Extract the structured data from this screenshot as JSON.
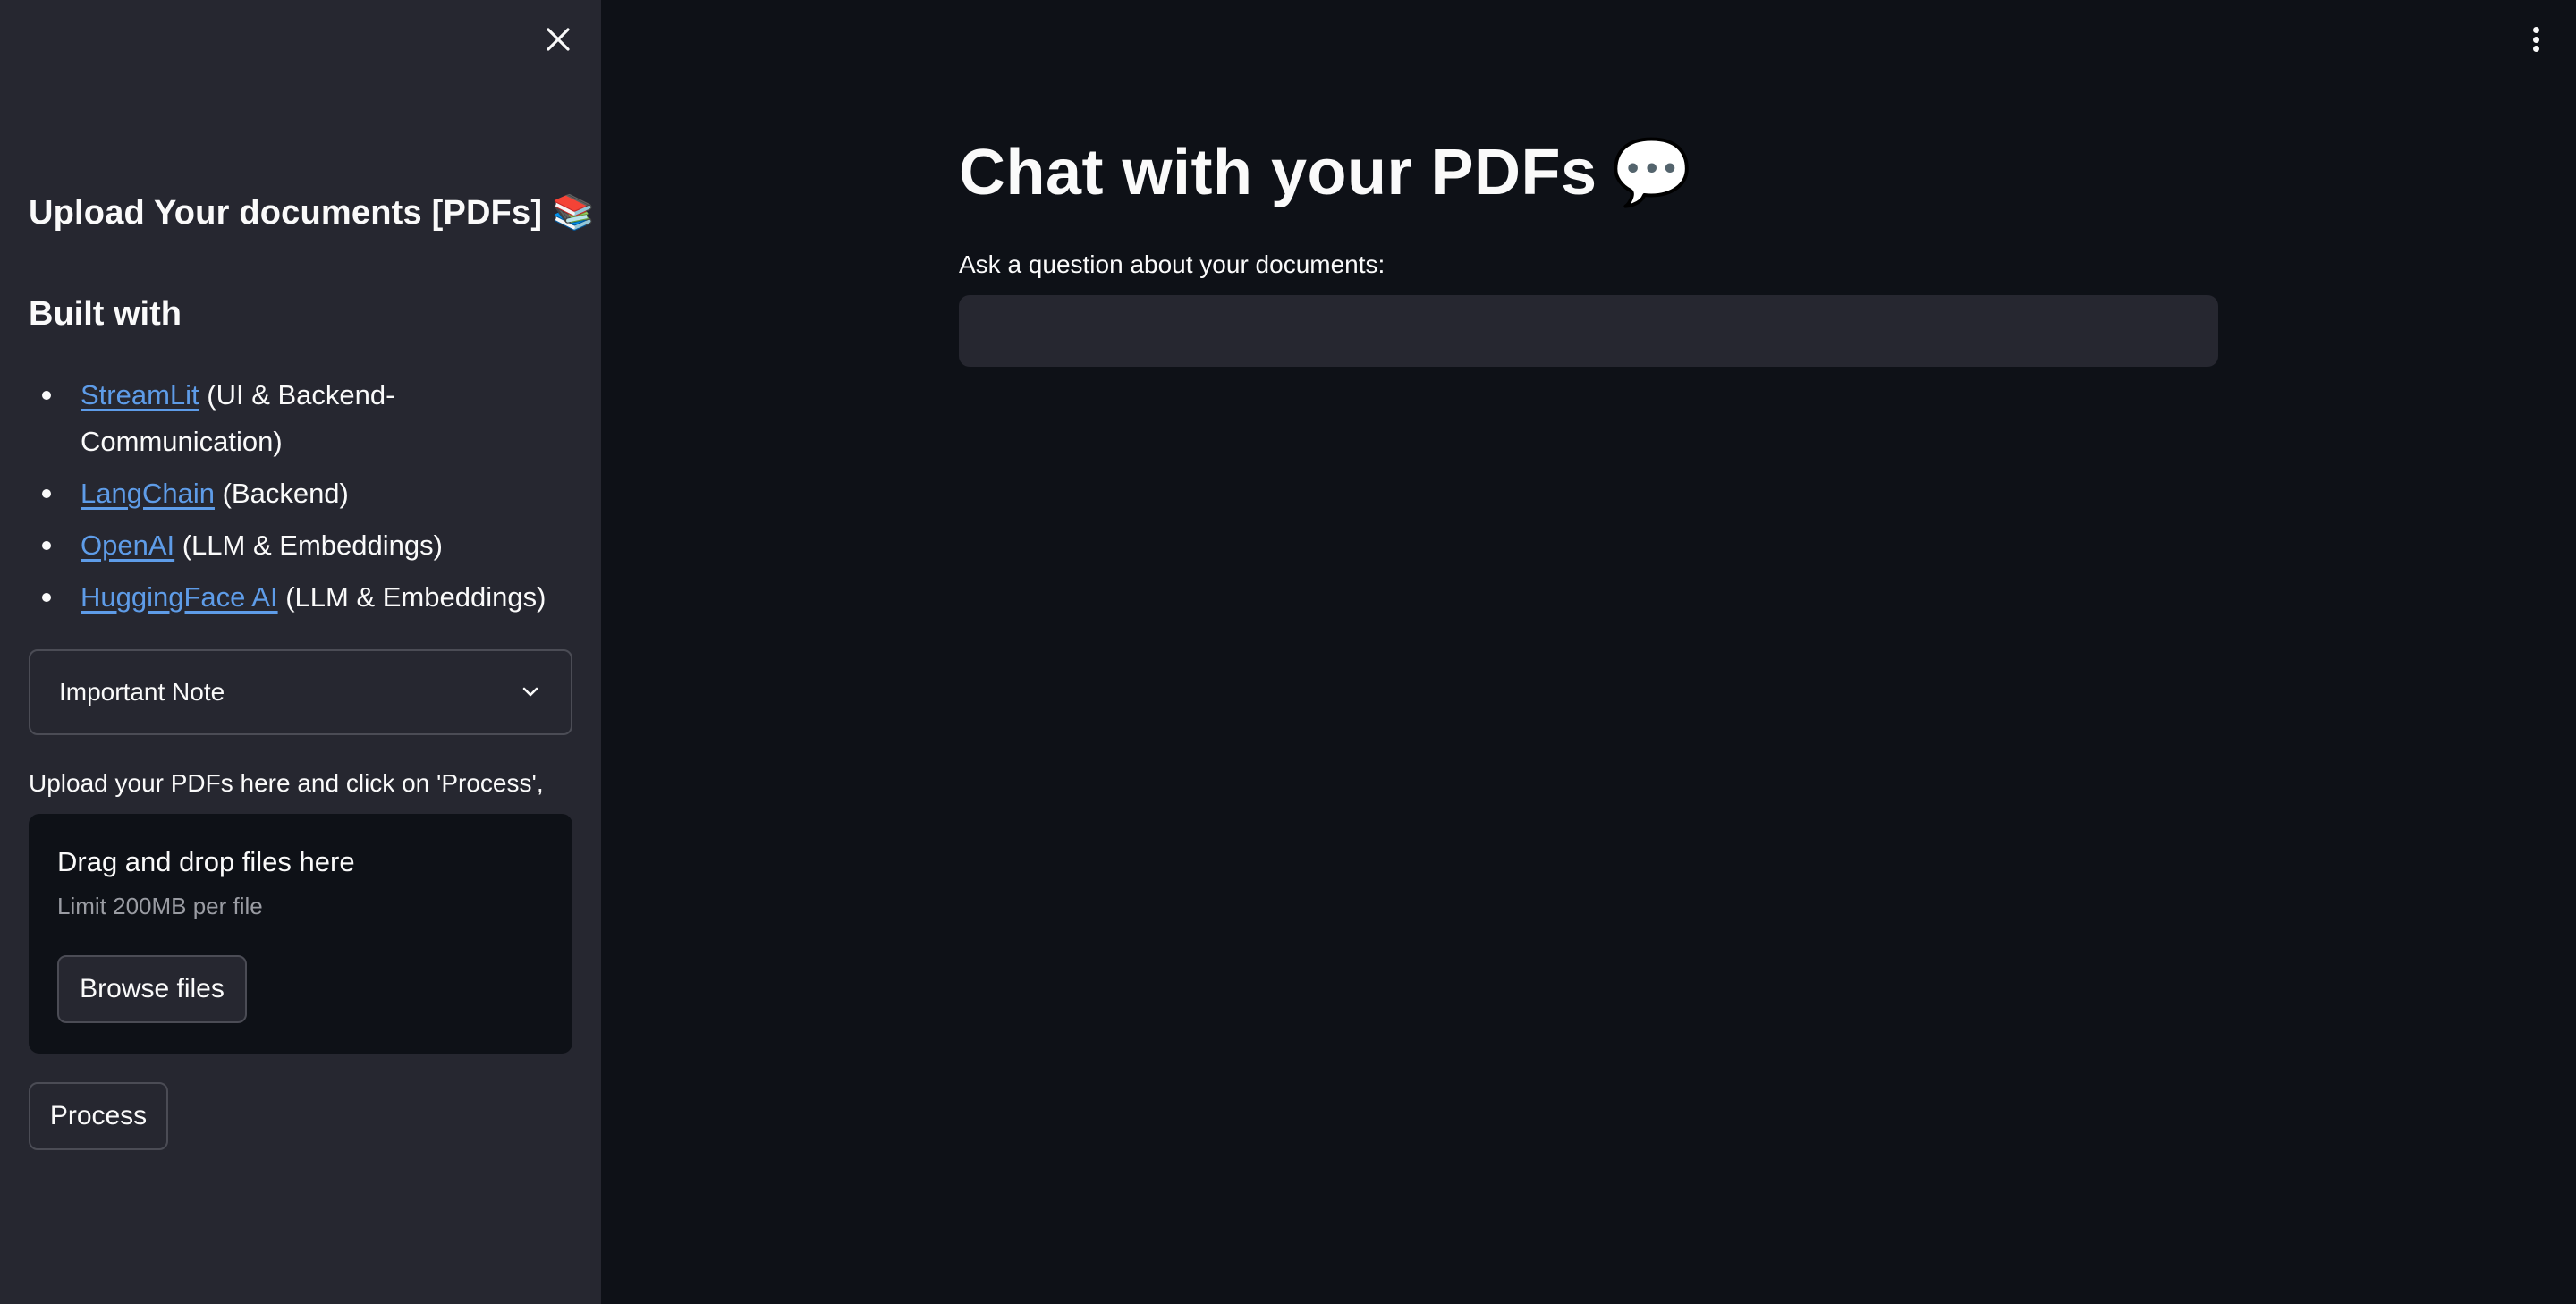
{
  "sidebar": {
    "upload_heading": "Upload Your documents [PDFs]",
    "upload_heading_emoji": "📚",
    "built_with_heading": "Built with",
    "tech_items": [
      {
        "link": "StreamLit",
        "desc": " (UI & Backend-Communication)"
      },
      {
        "link": "LangChain",
        "desc": " (Backend)"
      },
      {
        "link": "OpenAI",
        "desc": " (LLM & Embeddings)"
      },
      {
        "link": "HuggingFace AI",
        "desc": " (LLM & Embeddings)"
      }
    ],
    "expander_label": "Important Note",
    "upload_label": "Upload your PDFs here and click on 'Process',",
    "dropzone": {
      "title": "Drag and drop files here",
      "limit": "Limit 200MB per file",
      "browse_label": "Browse files"
    },
    "process_label": "Process",
    "icons": {
      "close": "close-icon",
      "expander": "chevron-down-icon"
    }
  },
  "main": {
    "title": "Chat with your PDFs",
    "title_emoji": "💬",
    "question_label": "Ask a question about your documents:",
    "question_value": "",
    "menu_icon": "more-vertical-icon"
  },
  "colors": {
    "background": "#0e1117",
    "sidebar": "#262730",
    "link": "#5e9ce8",
    "input": "#262730"
  }
}
